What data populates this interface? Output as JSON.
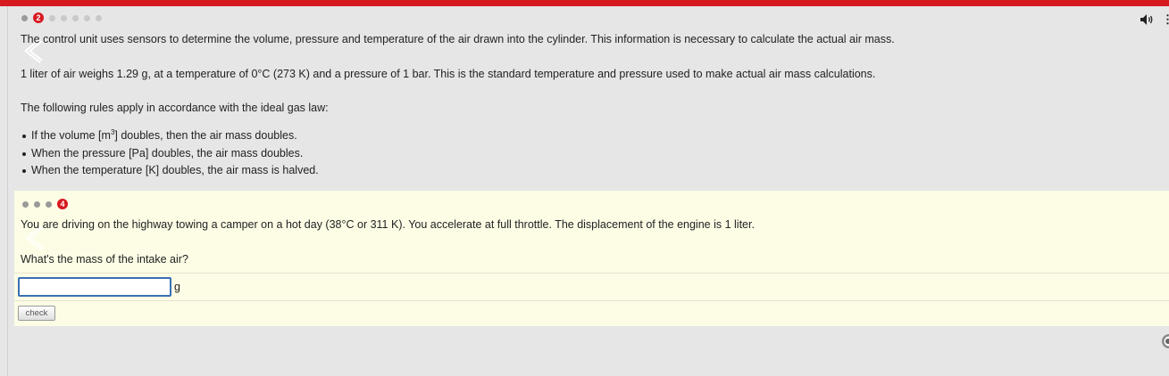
{
  "header": {
    "accent_color": "#d71920"
  },
  "section1": {
    "active_step": "2",
    "paragraphs": [
      "The control unit uses sensors to determine the volume, pressure and temperature of the air drawn into the cylinder. This information is necessary to calculate the actual air mass.",
      "1 liter of air weighs 1.29 g, at a temperature of 0°C (273 K) and a pressure of 1 bar. This is the standard temperature and pressure used to make actual air mass calculations.",
      "The following rules apply in accordance with the ideal gas law:"
    ],
    "bullets": {
      "b1_before": "If the volume [m",
      "b1_sup": "3",
      "b1_after": "] doubles, then the air mass doubles.",
      "b2": "When the pressure [Pa] doubles, the air mass doubles.",
      "b3": "When the temperature [K] doubles, the air mass is halved."
    }
  },
  "task": {
    "active_step": "4",
    "question_text": "You are driving on the highway towing a camper on a hot day (38°C or 311 K). You accelerate at full throttle. The displacement of the engine is 1 liter.",
    "question": "What's the mass of the intake air?",
    "answer_value": "",
    "unit": "g",
    "check_label": "check"
  }
}
